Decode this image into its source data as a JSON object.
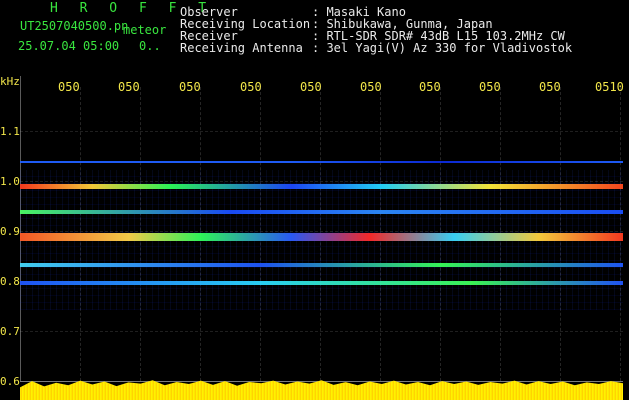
{
  "header": {
    "app_title": "H R O F F T",
    "file_name": "UT2507040500.pn",
    "meteor_label": "meteor",
    "date_time": "25.07.04 05:00",
    "counter": "0..",
    "observer_label": "Observer",
    "observer_value": ": Masaki Kano",
    "location_label": "Receiving Location",
    "location_value": ": Shibukawa, Gunma, Japan",
    "receiver_label": "Receiver",
    "receiver_value": ": RTL-SDR SDR# 43dB L15 103.2MHz CW",
    "antenna_label": "Receiving Antenna",
    "antenna_value": ": 3el Yagi(V) Az 330 for Vladivostok"
  },
  "axes": {
    "y_unit": "kHz",
    "y_ticks": [
      "1.1",
      "1.0",
      "0.9",
      "0.8",
      "0.7",
      "0.6"
    ],
    "x_ticks": [
      "050",
      "050",
      "050",
      "050",
      "050",
      "050",
      "050",
      "050",
      "050",
      "0510"
    ]
  },
  "colors": {
    "yellow": "#f2e64a",
    "green": "#39e63f",
    "white": "#eaeaea",
    "background": "#000000"
  }
}
